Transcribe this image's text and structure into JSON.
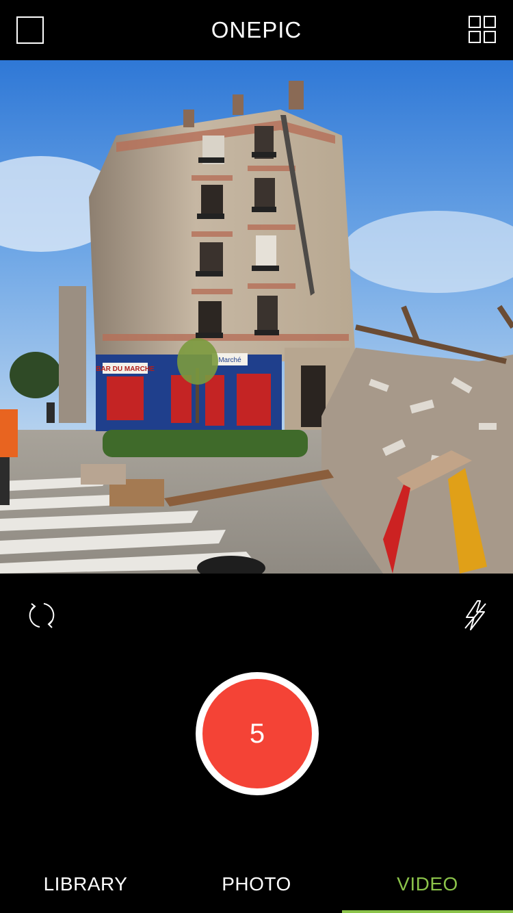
{
  "app": {
    "title": "ONEPIC"
  },
  "header": {
    "left_icon": "square-frame-icon",
    "right_icon": "grid-icon"
  },
  "viewfinder": {
    "description_icon": "camera-preview",
    "storefront_text_1": "BAR DU MARCHE",
    "storefront_text_2": "Marché"
  },
  "controls": {
    "rotate_icon": "rotate-camera-icon",
    "flash_icon": "flash-off-icon",
    "shutter_value": "5"
  },
  "tabs": [
    {
      "label": "LIBRARY",
      "active": false
    },
    {
      "label": "PHOTO",
      "active": false
    },
    {
      "label": "VIDEO",
      "active": true
    }
  ],
  "colors": {
    "accent": "#8bc34a",
    "shutter": "#f44336",
    "background": "#000000"
  }
}
